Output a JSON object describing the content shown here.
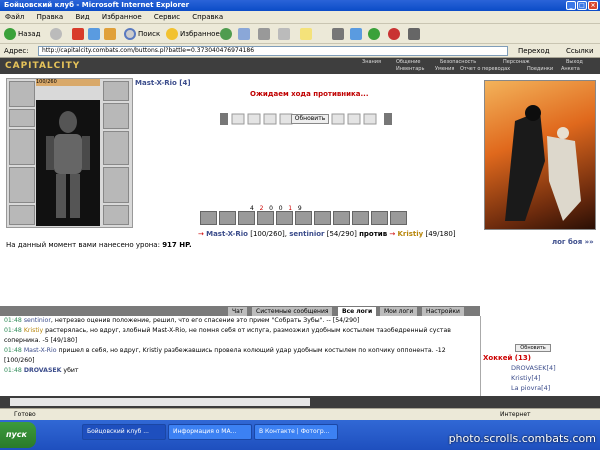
{
  "window": {
    "title": "Бойцовский клуб - Microsoft Internet Explorer"
  },
  "menu": [
    "Файл",
    "Правка",
    "Вид",
    "Избранное",
    "Сервис",
    "Справка"
  ],
  "toolbar": {
    "back": "Назад",
    "search": "Поиск",
    "favorites": "Избранное"
  },
  "address": {
    "label": "Адрес:",
    "url": "http://capitalcity.combats.com/buttons.pl?battle=0.373040476974186",
    "go": "Переход",
    "links": "Ссылки"
  },
  "game": {
    "logo": "CAPITALCITY",
    "nav": [
      "Знания",
      "Общение",
      "Безопасность",
      "Персонаж",
      "Выход"
    ],
    "subnav": [
      "Инвентарь",
      "Умения",
      "Отчет о переводах",
      "Поединки",
      "Анкета"
    ],
    "player_level": "100/260",
    "opponent": "Mast-X-Rio [4]",
    "waiting": "Ожидаем хода противника...",
    "refresh": "Обновить",
    "counters": [
      "4",
      "2",
      "0",
      "0",
      "1",
      "9"
    ],
    "vs": {
      "p1": "Mast-X-Rio",
      "p1hp": "[100/260]",
      "p2": "sentinior",
      "p2hp": "[54/290]",
      "word": "против",
      "p3": "Kristiy",
      "p3hp": "[49/180]"
    },
    "damage_text": "На данный момент вами нанесено урона:",
    "damage_val": "917 HP.",
    "log_link": "лог боя »»"
  },
  "chat": {
    "tabs": [
      "Чат",
      "Системные сообщения",
      "Все логи",
      "Мои логи",
      "Настройки"
    ],
    "lines": [
      {
        "t": "01:48",
        "n": "sentinior",
        "txt": ", нетрезво оценив положение, решил, что его спасение это прием \"Собрать Зубы\". -- [54/290]"
      },
      {
        "t": "01:48",
        "n": "Kristiy",
        "txt": " растерялась, но вдруг, злобный Mast-X-Rio, не помня себя от испуга, размозжил удобным костылем тазобедренный сустав соперника. -5 [49/180]"
      },
      {
        "t": "01:48",
        "n": "Mast-X-Rio",
        "txt": " пришел в себя, но вдруг, Kristiy разбежавшись провела колющий удар удобным костылем по копчику оппонента. -12 [100/260]"
      },
      {
        "t": "01:48",
        "n": "DROVASEK",
        "txt": " убит"
      }
    ]
  },
  "online": {
    "refresh": "Обновить",
    "room": "Хоккей (13)",
    "users": [
      "DROVASEK[4]",
      "Kristiy[4]",
      "La piovra[4]"
    ]
  },
  "status": {
    "text": "Готово",
    "zone": "Интернет"
  },
  "taskbar": {
    "start": "пуск",
    "tasks": [
      "Бойцовский клуб ...",
      "Информация о МА...",
      "В Контакте | Фотогр..."
    ],
    "clock": "1:48"
  },
  "watermark": "photo.scrolls.combats.com"
}
